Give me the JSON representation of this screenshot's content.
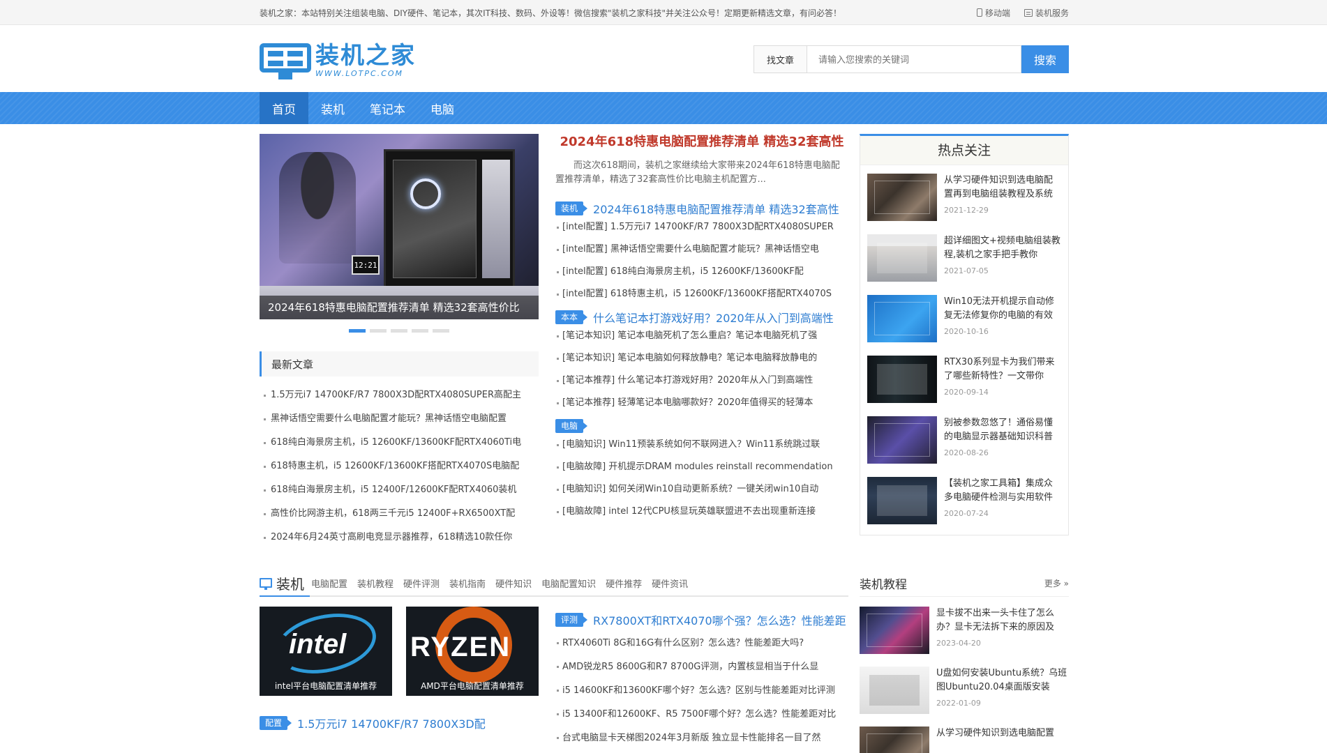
{
  "topbar": {
    "notice": "装机之家：本站特别关注组装电脑、DIY硬件、笔记本，其次IT科技、数码、外设等！微信搜索\"装机之家科技\"并关注公众号！定期更新精选文章，有问必答！",
    "mobile": "移动端",
    "service": "装机服务"
  },
  "logo": {
    "cn": "装机之家",
    "en": "WWW.LOTPC.COM"
  },
  "search": {
    "label": "找文章",
    "placeholder": "请输入您搜索的关键词",
    "button": "搜索"
  },
  "nav": [
    "首页",
    "装机",
    "笔记本",
    "电脑"
  ],
  "slider": {
    "caption": "2024年618特惠电脑配置推荐清单 精选32套高性价比",
    "monitor_time": "12:21"
  },
  "latest": {
    "title": "最新文章",
    "items": [
      "1.5万元i7 14700KF/R7 7800X3D配RTX4080SUPER高配主",
      "黑神话悟空需要什么电脑配置才能玩？黑神话悟空电脑配置",
      "618纯白海景房主机，i5 12600KF/13600KF配RTX4060Ti电",
      "618特惠主机，i5 12600KF/13600KF搭配RTX4070S电脑配",
      "618纯白海景房主机，i5 12400F/12600KF配RTX4060装机",
      "高性价比网游主机，618两三千元i5 12400F+RX6500XT配",
      "2024年6月24英寸高刷电竞显示器推荐，618精选10款任你"
    ]
  },
  "middle": {
    "headline": "2024年618特惠电脑配置推荐清单 精选32套高性",
    "summary": "而这次618期间，装机之家继续给大家带来2024年618特惠电脑配置推荐清单，精选了32套高性价比电脑主机配置方...",
    "categories": [
      {
        "tag": "装机",
        "title": "2024年618特惠电脑配置推荐清单 精选32套高性",
        "items": [
          "[intel配置] 1.5万元i7 14700KF/R7 7800X3D配RTX4080SUPER",
          "[intel配置] 黑神话悟空需要什么电脑配置才能玩？黑神话悟空电",
          "[intel配置] 618纯白海景房主机，i5 12600KF/13600KF配",
          "[intel配置] 618特惠主机，i5 12600KF/13600KF搭配RTX4070S"
        ]
      },
      {
        "tag": "本本",
        "title": "什么笔记本打游戏好用？2020年从入门到高端性",
        "items": [
          "[笔记本知识] 笔记本电脑死机了怎么重启？笔记本电脑死机了强",
          "[笔记本知识] 笔记本电脑如何释放静电？笔记本电脑释放静电的",
          "[笔记本推荐] 什么笔记本打游戏好用？2020年从入门到高端性",
          "[笔记本推荐] 轻薄笔记本电脑哪款好？2020年值得买的轻薄本"
        ]
      },
      {
        "tag": "电脑",
        "title": "",
        "items": [
          "[电脑知识] Win11预装系统如何不联网进入？Win11系统跳过联",
          "[电脑故障] 开机提示DRAM modules reinstall recommendation",
          "[电脑知识] 如何关闭Win10自动更新系统？一键关闭win10自动",
          "[电脑故障] intel 12代CPU核显玩英雄联盟进不去出现重新连接"
        ]
      }
    ]
  },
  "hot": {
    "title": "热点关注",
    "items": [
      {
        "title": "从学习硬件知识到选电脑配置再到电脑组装教程及系统",
        "date": "2021-12-29"
      },
      {
        "title": "超详细图文+视频电脑组装教程,装机之家手把手教你",
        "date": "2021-07-05"
      },
      {
        "title": "Win10无法开机提示自动修复无法修复你的电脑的有效",
        "date": "2020-10-16"
      },
      {
        "title": "RTX30系列显卡为我们带来了哪些新特性？一文带你",
        "date": "2020-09-14"
      },
      {
        "title": "别被参数忽悠了！通俗易懂的电脑显示器基础知识科普",
        "date": "2020-08-26"
      },
      {
        "title": "【装机之家工具箱】集成众多电脑硬件检测与实用软件",
        "date": "2020-07-24"
      }
    ]
  },
  "zhuangji": {
    "name": "装机",
    "subs": [
      "电脑配置",
      "装机教程",
      "硬件评测",
      "装机指南",
      "硬件知识",
      "电脑配置知识",
      "硬件推荐",
      "硬件资讯"
    ],
    "images": [
      {
        "brand": "intel",
        "caption": "intel平台电脑配置清单推荐"
      },
      {
        "brand": "RYZEN",
        "caption": "AMD平台电脑配置清单推荐"
      }
    ],
    "left_cat": {
      "tag": "配置",
      "title": "1.5万元i7 14700KF/R7 7800X3D配"
    },
    "right_cat": {
      "tag": "评测",
      "title": "RX7800XT和RTX4070哪个强？怎么选？性能差距",
      "items": [
        "RTX4060Ti 8G和16G有什么区别？怎么选？性能差距大吗?",
        "AMD锐龙R5 8600G和R7 8700G评测，内置核显相当于什么显",
        "i5 14600KF和13600KF哪个好？怎么选？区别与性能差距对比评测",
        "i5 13400F和12600KF、R5 7500F哪个好？怎么选？性能差距对比",
        "台式电脑显卡天梯图2024年3月新版 独立显卡性能排名一目了然"
      ]
    }
  },
  "tutorials": {
    "name": "装机教程",
    "more": "更多 »",
    "items": [
      {
        "title": "显卡拔不出来一头卡住了怎么办？显卡无法拆下来的原因及",
        "date": "2023-04-20"
      },
      {
        "title": "U盘如何安装Ubuntu系统？乌班图Ubuntu20.04桌面版安装",
        "date": "2022-01-09"
      },
      {
        "title": "从学习硬件知识到选电脑配置",
        "date": ""
      }
    ]
  }
}
